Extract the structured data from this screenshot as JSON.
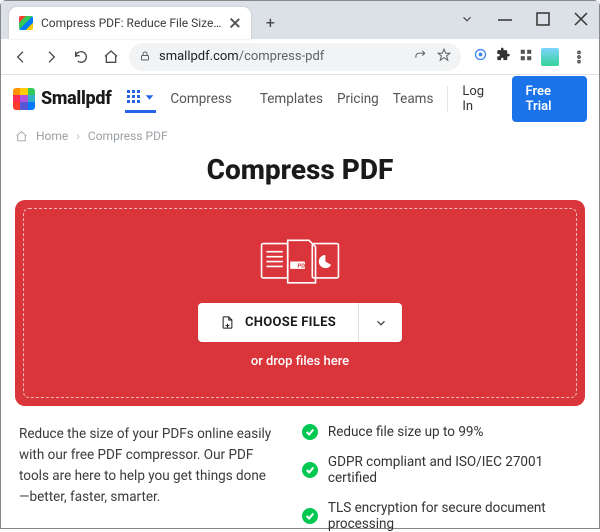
{
  "window": {
    "tab_title": "Compress PDF: Reduce File Size…"
  },
  "toolbar": {
    "url_host": "smallpdf.com",
    "url_path": "/compress-pdf"
  },
  "header": {
    "brand": "Smallpdf",
    "nav": {
      "compress": "Compress",
      "templates": "Templates",
      "pricing": "Pricing",
      "teams": "Teams"
    },
    "login": "Log In",
    "free_trial": "Free Trial"
  },
  "breadcrumb": {
    "home": "Home",
    "current": "Compress PDF"
  },
  "hero": {
    "title": "Compress PDF",
    "choose_label": "CHOOSE FILES",
    "drop_hint": "or drop files here",
    "pdf_badge": "PDF"
  },
  "description": "Reduce the size of your PDFs online easily with our free PDF compressor. Our PDF tools are here to help you get things done—better, faster, smarter.",
  "bullets": {
    "b1": "Reduce file size up to 99%",
    "b2": "GDPR compliant and ISO/IEC 27001 certified",
    "b3": "TLS encryption for secure document processing"
  }
}
